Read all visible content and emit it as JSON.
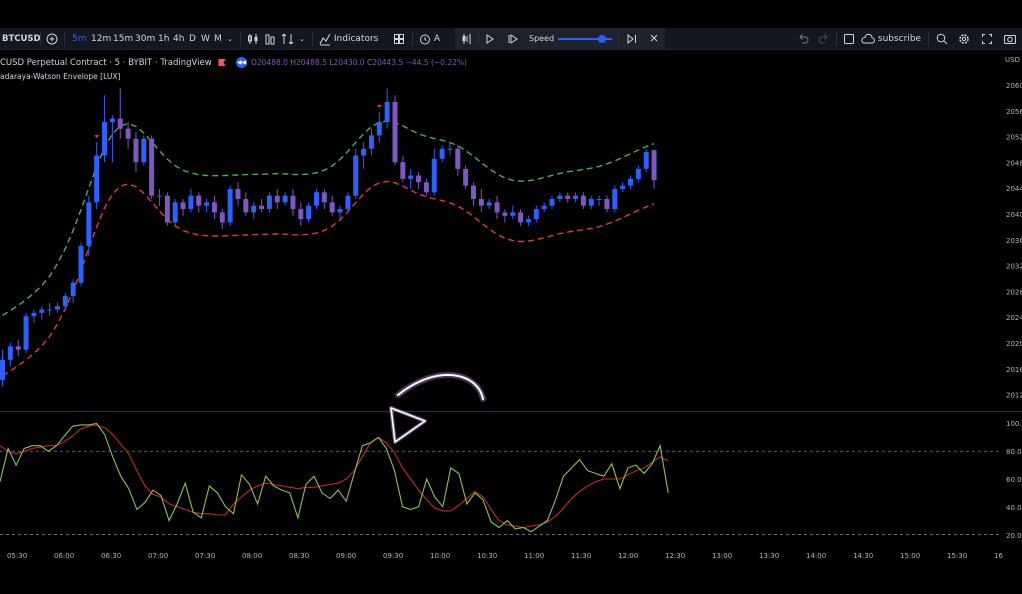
{
  "toolbar": {
    "symbol": "BTCUSD",
    "intervals": [
      "5m",
      "12m",
      "15m",
      "30m",
      "1h",
      "4h",
      "D",
      "W",
      "M"
    ],
    "active_interval": "5m",
    "indicators_label": "Indicators",
    "alert_label": "A",
    "speed_label": "Speed",
    "subscribe_label": "subscribe"
  },
  "legend": {
    "title": "CUSD Perpetual Contract · 5 · BYBIT · TradingView",
    "o_label": "O",
    "o": "20488.0",
    "h_label": "H",
    "h": "20488.5",
    "l_label": "L",
    "l": "20430.0",
    "c_label": "C",
    "c": "20443.5",
    "change": "−44.5 (−0.22%)",
    "indicator": "adaraya-Watson Envelope [LUX]"
  },
  "price_axis": {
    "currency": "USD",
    "labels": [
      "2060",
      "2056",
      "2052",
      "2048",
      "2044",
      "2040",
      "2036",
      "2032",
      "2028",
      "2024",
      "2020",
      "2016",
      "2012"
    ]
  },
  "oscillator_axis": {
    "labels": [
      "100.0",
      "80.0",
      "60.0",
      "40.0",
      "20.0"
    ]
  },
  "time_axis": {
    "labels": [
      "05:30",
      "06:00",
      "06:30",
      "07:00",
      "07:30",
      "08:00",
      "08:30",
      "09:00",
      "09:30",
      "10:00",
      "10:30",
      "11:00",
      "11:30",
      "12:00",
      "12:30",
      "13:00",
      "13:30",
      "14:00",
      "14:30",
      "15:00",
      "15:30",
      "16"
    ]
  },
  "colors": {
    "up_candle": "#2962ff",
    "down_candle": "#7e57c2",
    "upper_band": "#4caf50",
    "lower_band": "#e53935",
    "stoch_k": "#8bc34a",
    "stoch_d": "#c62828",
    "arrow": "#d59cff",
    "background": "#000000"
  },
  "chart_data": [
    {
      "type": "candlestick",
      "ylim": [
        20100,
        20630
      ],
      "candles": [
        [
          20145,
          20175,
          20135,
          20190
        ],
        [
          20175,
          20195,
          20165,
          20200
        ],
        [
          20195,
          20190,
          20180,
          20205
        ],
        [
          20190,
          20240,
          20185,
          20245
        ],
        [
          20240,
          20245,
          20230,
          20250
        ],
        [
          20245,
          20250,
          20235,
          20255
        ],
        [
          20250,
          20250,
          20240,
          20260
        ],
        [
          20250,
          20255,
          20245,
          20260
        ],
        [
          20255,
          20270,
          20250,
          20275
        ],
        [
          20270,
          20290,
          20260,
          20295
        ],
        [
          20290,
          20345,
          20285,
          20350
        ],
        [
          20345,
          20410,
          20330,
          20420
        ],
        [
          20410,
          20480,
          20400,
          20500
        ],
        [
          20480,
          20530,
          20470,
          20570
        ],
        [
          20530,
          20535,
          20470,
          20540
        ],
        [
          20535,
          20520,
          20505,
          20580
        ],
        [
          20520,
          20505,
          20490,
          20530
        ],
        [
          20505,
          20470,
          20455,
          20515
        ],
        [
          20470,
          20505,
          20465,
          20510
        ],
        [
          20505,
          20420,
          20415,
          20510
        ],
        [
          20420,
          20420,
          20405,
          20430
        ],
        [
          20420,
          20380,
          20375,
          20425
        ],
        [
          20380,
          20410,
          20375,
          20415
        ],
        [
          20410,
          20400,
          20390,
          20415
        ],
        [
          20400,
          20420,
          20395,
          20430
        ],
        [
          20420,
          20405,
          20395,
          20425
        ],
        [
          20405,
          20410,
          20395,
          20415
        ],
        [
          20410,
          20395,
          20385,
          20420
        ],
        [
          20395,
          20380,
          20370,
          20400
        ],
        [
          20380,
          20430,
          20375,
          20435
        ],
        [
          20430,
          20415,
          20405,
          20440
        ],
        [
          20415,
          20395,
          20390,
          20425
        ],
        [
          20395,
          20405,
          20385,
          20410
        ],
        [
          20405,
          20400,
          20395,
          20415
        ],
        [
          20400,
          20420,
          20395,
          20425
        ],
        [
          20420,
          20410,
          20400,
          20430
        ],
        [
          20410,
          20420,
          20405,
          20425
        ],
        [
          20420,
          20400,
          20390,
          20430
        ],
        [
          20400,
          20385,
          20375,
          20410
        ],
        [
          20385,
          20405,
          20380,
          20410
        ],
        [
          20405,
          20425,
          20400,
          20430
        ],
        [
          20425,
          20410,
          20400,
          20430
        ],
        [
          20410,
          20395,
          20390,
          20420
        ],
        [
          20395,
          20400,
          20385,
          20405
        ],
        [
          20400,
          20420,
          20395,
          20425
        ],
        [
          20420,
          20480,
          20415,
          20490
        ],
        [
          20480,
          20490,
          20460,
          20500
        ],
        [
          20490,
          20510,
          20480,
          20520
        ],
        [
          20510,
          20530,
          20500,
          20545
        ],
        [
          20530,
          20560,
          20520,
          20580
        ],
        [
          20560,
          20470,
          20465,
          20570
        ],
        [
          20470,
          20445,
          20440,
          20480
        ],
        [
          20445,
          20450,
          20430,
          20460
        ],
        [
          20450,
          20440,
          20430,
          20455
        ],
        [
          20440,
          20425,
          20420,
          20445
        ],
        [
          20425,
          20475,
          20420,
          20490
        ],
        [
          20475,
          20490,
          20470,
          20495
        ],
        [
          20490,
          20490,
          20480,
          20500
        ],
        [
          20490,
          20460,
          20450,
          20495
        ],
        [
          20460,
          20435,
          20430,
          20465
        ],
        [
          20435,
          20415,
          20405,
          20440
        ],
        [
          20415,
          20405,
          20395,
          20430
        ],
        [
          20405,
          20410,
          20400,
          20415
        ],
        [
          20410,
          20395,
          20385,
          20420
        ],
        [
          20395,
          20390,
          20380,
          20400
        ],
        [
          20390,
          20395,
          20385,
          20405
        ],
        [
          20395,
          20380,
          20375,
          20400
        ],
        [
          20380,
          20385,
          20375,
          20390
        ],
        [
          20385,
          20400,
          20380,
          20405
        ],
        [
          20400,
          20405,
          20395,
          20410
        ],
        [
          20405,
          20415,
          20400,
          20420
        ],
        [
          20415,
          20420,
          20410,
          20425
        ],
        [
          20420,
          20415,
          20410,
          20425
        ],
        [
          20415,
          20420,
          20410,
          20425
        ],
        [
          20420,
          20405,
          20400,
          20425
        ],
        [
          20405,
          20415,
          20400,
          20420
        ],
        [
          20415,
          20415,
          20405,
          20420
        ],
        [
          20415,
          20400,
          20395,
          20420
        ],
        [
          20400,
          20430,
          20395,
          20435
        ],
        [
          20430,
          20435,
          20425,
          20440
        ],
        [
          20435,
          20445,
          20430,
          20450
        ],
        [
          20445,
          20460,
          20440,
          20465
        ],
        [
          20460,
          20485,
          20455,
          20490
        ],
        [
          20488,
          20443,
          20430,
          20488
        ]
      ]
    },
    {
      "type": "line",
      "series": [
        {
          "values": [
            84,
            80,
            78,
            80,
            82,
            83,
            84,
            84,
            87,
            91,
            96,
            98,
            99,
            97,
            92,
            85,
            78,
            66,
            55,
            49,
            47,
            42,
            40,
            38,
            36,
            35,
            35,
            34,
            34,
            42,
            47,
            52,
            55,
            57,
            56,
            55,
            54,
            53,
            54,
            54,
            55,
            56,
            57,
            60,
            66,
            76,
            86,
            90,
            86,
            79,
            68,
            60,
            52,
            45,
            39,
            37,
            37,
            41,
            46,
            51,
            47,
            38,
            30,
            27,
            26,
            25,
            26,
            27,
            29,
            33,
            39,
            46,
            51,
            55,
            58,
            60,
            60,
            60,
            63,
            66,
            68,
            72,
            76,
            73
          ]
        },
        {
          "values": [
            58,
            82,
            70,
            82,
            84,
            84,
            80,
            84,
            91,
            98,
            99,
            99,
            100,
            92,
            76,
            62,
            53,
            38,
            43,
            52,
            48,
            30,
            42,
            57,
            36,
            32,
            55,
            50,
            40,
            35,
            63,
            56,
            42,
            62,
            55,
            52,
            50,
            32,
            56,
            62,
            50,
            46,
            52,
            44,
            64,
            84,
            86,
            90,
            82,
            66,
            40,
            38,
            40,
            60,
            47,
            40,
            68,
            64,
            42,
            50,
            45,
            29,
            25,
            30,
            24,
            25,
            22,
            26,
            30,
            45,
            62,
            68,
            74,
            66,
            64,
            62,
            71,
            53,
            68,
            70,
            64,
            71,
            84,
            50
          ]
        }
      ]
    }
  ]
}
